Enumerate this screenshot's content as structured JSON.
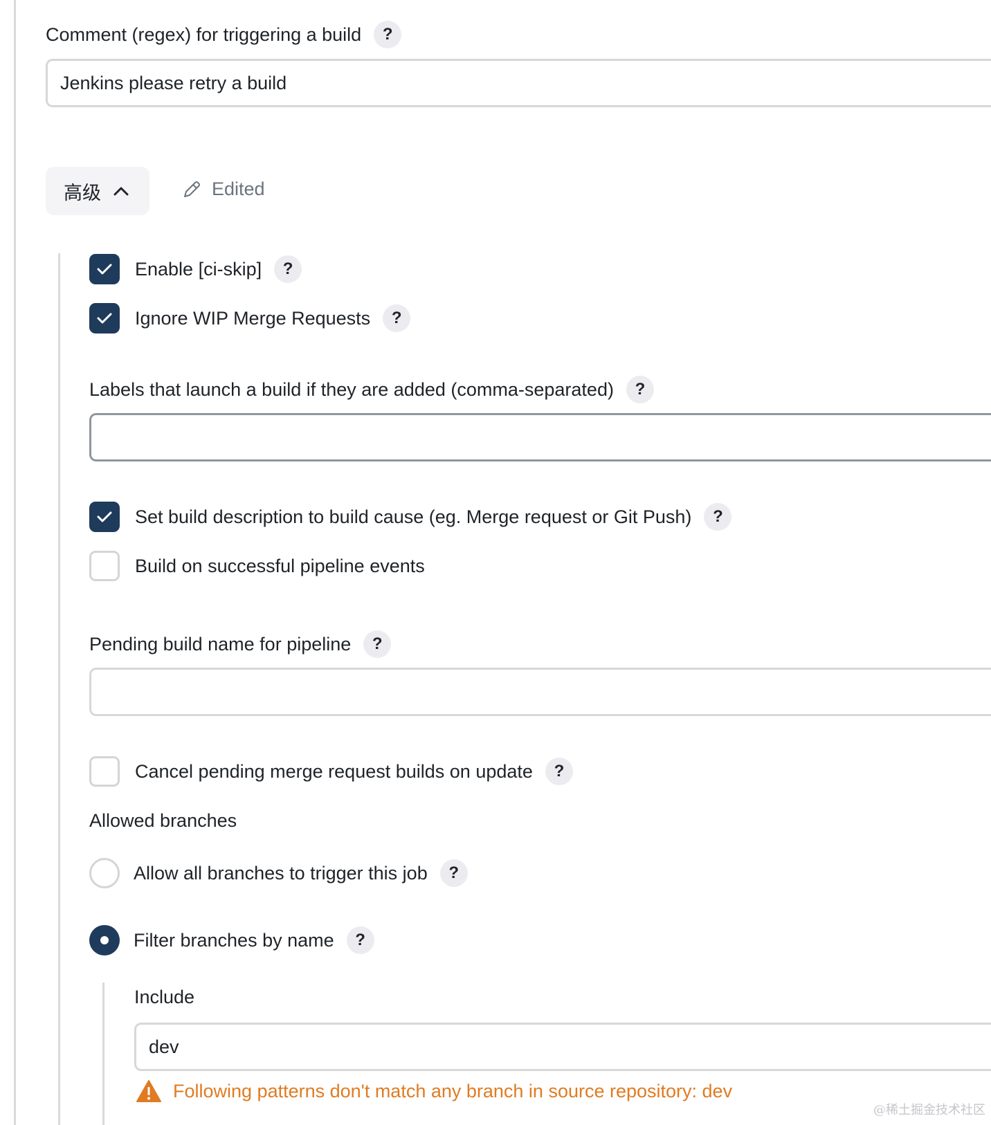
{
  "comment": {
    "label": "Comment (regex) for triggering a build",
    "value": "Jenkins please retry a build"
  },
  "advanced": {
    "button_label": "高级",
    "edited_label": "Edited"
  },
  "options": {
    "ci_skip": {
      "label": "Enable [ci-skip]",
      "checked": true
    },
    "ignore_wip": {
      "label": "Ignore WIP Merge Requests",
      "checked": true
    },
    "labels_launch": {
      "label": "Labels that launch a build if they are added (comma-separated)",
      "value": ""
    },
    "set_build_desc": {
      "label": "Set build description to build cause (eg. Merge request or Git Push)",
      "checked": true
    },
    "build_on_pipeline": {
      "label": "Build on successful pipeline events",
      "checked": false
    },
    "pending_build_name": {
      "label": "Pending build name for pipeline",
      "value": ""
    },
    "cancel_pending": {
      "label": "Cancel pending merge request builds on update",
      "checked": false
    }
  },
  "branches": {
    "heading": "Allowed branches",
    "allow_all": {
      "label": "Allow all branches to trigger this job",
      "selected": false
    },
    "filter_by_name": {
      "label": "Filter branches by name",
      "selected": true
    },
    "include_label": "Include",
    "include_value": "dev",
    "warning": "Following patterns don't match any branch in source repository: dev"
  },
  "help_glyph": "?",
  "watermark": "@稀土掘金技术社区",
  "colors": {
    "checkbox_on": "#1f3b5c",
    "warning": "#e07b22",
    "border": "#d7d7dc"
  }
}
